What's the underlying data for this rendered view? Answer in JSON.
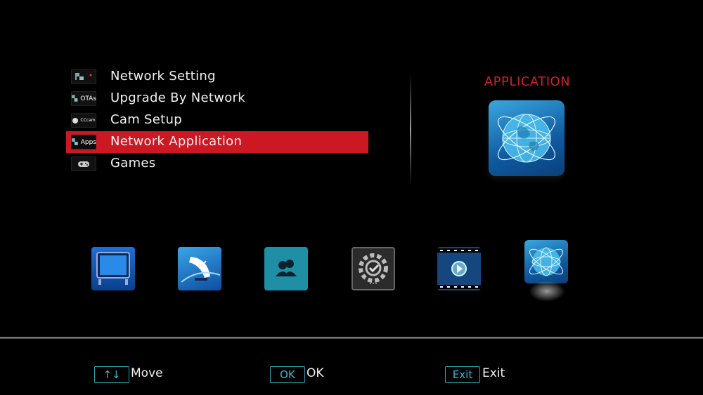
{
  "menu": {
    "items": [
      {
        "label": "Network Setting",
        "icon": "network-icon",
        "icon_text": ""
      },
      {
        "label": "Upgrade By Network",
        "icon": "otas-icon",
        "icon_text": "OTAs"
      },
      {
        "label": "Cam Setup",
        "icon": "cccam-icon",
        "icon_text": "CCcam"
      },
      {
        "label": "Network Application",
        "icon": "apps-icon",
        "icon_text": "Apps",
        "selected": true
      },
      {
        "label": "Games",
        "icon": "gamepad-icon",
        "icon_text": ""
      }
    ]
  },
  "preview": {
    "title": "APPLICATION",
    "icon": "globe-icon"
  },
  "bottom_bar": {
    "icons": [
      "tv-icon",
      "satellite-icon",
      "users-icon",
      "gear-icon",
      "media-icon",
      "globe-icon"
    ],
    "selected_index": 5
  },
  "footer": {
    "move_key": "↑↓",
    "move_label": "Move",
    "ok_key": "OK",
    "ok_label": "OK",
    "exit_key": "Exit",
    "exit_label": "Exit"
  },
  "colors": {
    "accent_red": "#cc1822",
    "title_red": "#d31e24",
    "key_cyan": "#2fb8d0"
  }
}
